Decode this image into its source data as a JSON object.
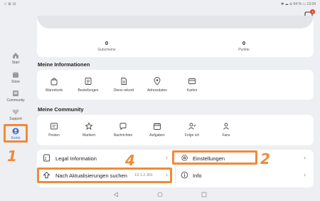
{
  "status_bar": {
    "left": "□ ⊞ ⊟",
    "right": "✱ ☁ ⊘ 54 % ▭ 13:34"
  },
  "chat": {
    "badge": "1"
  },
  "sidebar": {
    "items": [
      {
        "label": "Start",
        "icon": "home-icon"
      },
      {
        "label": "Store",
        "icon": "store-icon"
      },
      {
        "label": "Community",
        "icon": "community-icon"
      },
      {
        "label": "Support",
        "icon": "heart-icon"
      },
      {
        "label": "Konto",
        "icon": "account-icon",
        "active": true
      }
    ]
  },
  "stats": {
    "gutscheine": {
      "value": "0",
      "label": "Gutscheine"
    },
    "punkte": {
      "value": "0",
      "label": "Punkte"
    }
  },
  "meine_informationen": {
    "title": "Meine Informationen",
    "items": [
      {
        "label": "Warenkorb",
        "icon": "bag-icon"
      },
      {
        "label": "Bestellungen",
        "icon": "order-icon"
      },
      {
        "label": "Diens rekord",
        "icon": "document-icon"
      },
      {
        "label": "Adressdaten",
        "icon": "location-icon"
      },
      {
        "label": "Karten",
        "icon": "card-icon"
      }
    ]
  },
  "meine_community": {
    "title": "Meine Community",
    "items": [
      {
        "label": "Posten",
        "icon": "post-icon"
      },
      {
        "label": "Markiert",
        "icon": "star-icon"
      },
      {
        "label": "Nachrichten",
        "icon": "message-icon"
      },
      {
        "label": "Aufgaben",
        "icon": "calendar-icon"
      },
      {
        "label": "Folge ich",
        "icon": "follow-icon"
      },
      {
        "label": "Fans",
        "icon": "fans-icon"
      }
    ]
  },
  "settings_rows": {
    "legal": {
      "label": "Legal Information"
    },
    "einstellungen": {
      "label": "Einstellungen"
    },
    "update": {
      "label": "Nach Aktualisierungen suchen",
      "version": "13.1.2.301"
    },
    "info": {
      "label": "Info"
    }
  },
  "annotations": {
    "one": "1",
    "two": "2",
    "four": "4"
  },
  "colors": {
    "accent": "#3a6fd8",
    "highlight": "#f08a3a",
    "badge": "#e5402f"
  }
}
